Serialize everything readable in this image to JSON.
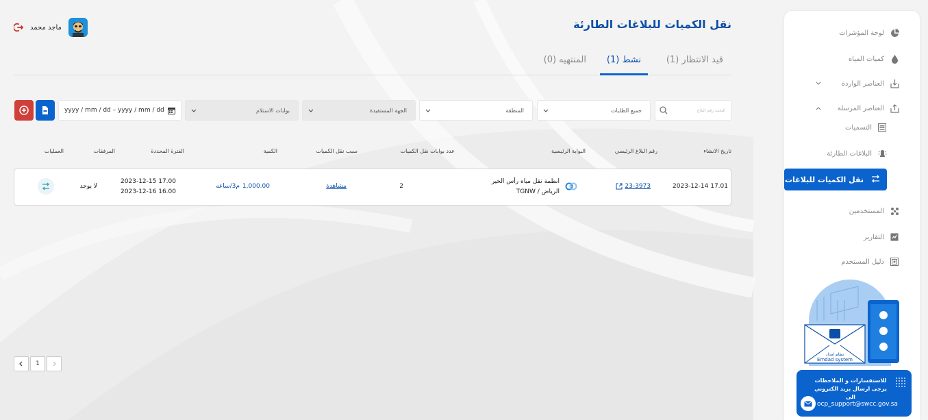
{
  "header": {
    "title": "نقل الكميات للبلاغات الطارئة",
    "user_name": "ماجد محمد"
  },
  "tabs": [
    {
      "label": "قيد الانتظار (1)"
    },
    {
      "label": "نشط (1)"
    },
    {
      "label": "المنتهيه (0)"
    }
  ],
  "filters": {
    "search_placeholder": "البحث رقم البلاغ",
    "requests": "جميع الطلبات",
    "region": "المنطقة",
    "beneficiary": "الجهة المستفيدة",
    "gates": "بوابات الاستلام",
    "date_range": "yyyy / mm / dd – yyyy / mm / dd"
  },
  "table": {
    "headers": [
      "تاريخ الانشاء",
      "رقم البلاغ الرئيسي",
      "البوابة الرئيسية",
      "عدد بوابات نقل الكميات",
      "سبب نقل الكميات",
      "الكمية",
      "الفترة المحددة",
      "المرفقات",
      "العمليات"
    ],
    "rows": [
      {
        "created": "17.01 2023-12-14",
        "report_no": "23-3973",
        "gate_line1": "انظمة نقل مياه رأس الخير",
        "gate_line2": "الرياض / TGNW",
        "gates_count": "2",
        "reason": "مشاهدة",
        "quantity": "1,000.00",
        "unit": "م3/ساعه",
        "period_start": "17.00 2023-12-15",
        "period_end": "16.00 2023-12-16",
        "attachments": "لا يوجد"
      }
    ]
  },
  "pagination": {
    "current": "1"
  },
  "sidebar": {
    "items": [
      {
        "label": "لوحة المؤشرات",
        "icon": "pie-chart-icon"
      },
      {
        "label": "كميات المياه",
        "icon": "water-drop-icon"
      },
      {
        "label": "العناصر الواردة",
        "icon": "inbox-icon"
      },
      {
        "label": "العناصر المرسلة",
        "icon": "outbox-icon"
      },
      {
        "label": "التسميات",
        "icon": "tags-icon"
      },
      {
        "label": "البلاغات الطارئة",
        "icon": "alert-icon"
      },
      {
        "label": "نقل الكميات للبلاغات",
        "icon": "transfer-icon"
      },
      {
        "label": "المستخدمين",
        "icon": "users-icon"
      },
      {
        "label": "التقارير",
        "icon": "report-icon"
      },
      {
        "label": "دليل المستخدم",
        "icon": "guide-icon"
      }
    ],
    "illustration": {
      "system_ar": "نظام امداد",
      "system_en": "Emdad system"
    },
    "support": {
      "text": "للاستفسارات و الملاحظات يرجى ارسال بريد الكتروني الى",
      "email": "ocp_support@swcc.gov.sa"
    }
  },
  "colors": {
    "primary": "#0b63ce",
    "title": "#0b4fa8",
    "danger": "#d0403a"
  }
}
